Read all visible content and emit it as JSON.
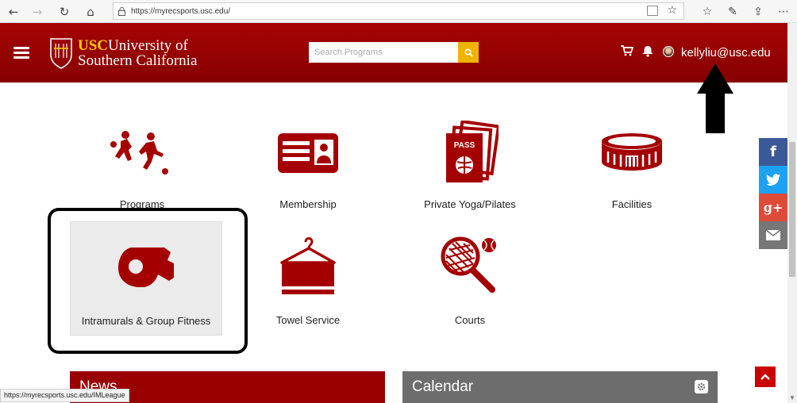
{
  "browser": {
    "url": "https://myrecsports.usc.edu/",
    "status_url": "https://myrecsports.usc.edu/IMLeague"
  },
  "header": {
    "logo_usc": "USC",
    "logo_line1": "University of",
    "logo_line2": "Southern California",
    "search_placeholder": "Search Programs",
    "user_email": "kellyliu@usc.edu"
  },
  "tiles": [
    {
      "label": "Programs",
      "icon": "soccer-players-icon"
    },
    {
      "label": "Membership",
      "icon": "membership-card-icon"
    },
    {
      "label": "Private Yoga/Pilates",
      "icon": "pass-icon"
    },
    {
      "label": "Facilities",
      "icon": "stadium-icon"
    },
    {
      "label": "Intramurals & Group Fitness",
      "icon": "whistle-icon"
    },
    {
      "label": "Towel Service",
      "icon": "towel-hanger-icon"
    },
    {
      "label": "Courts",
      "icon": "tennis-racket-icon"
    }
  ],
  "social": [
    {
      "name": "facebook",
      "glyph": "f",
      "color": "#3b5998"
    },
    {
      "name": "twitter",
      "glyph": "t",
      "color": "#1da1f2"
    },
    {
      "name": "google-plus",
      "glyph": "g+",
      "color": "#dd4b39"
    },
    {
      "name": "email",
      "glyph": "✉",
      "color": "#777777"
    }
  ],
  "panels": {
    "news_title": "News",
    "calendar_title": "Calendar"
  },
  "colors": {
    "brand_red": "#990000",
    "usc_gold": "#ffcc00",
    "search_button": "#f0b400"
  }
}
